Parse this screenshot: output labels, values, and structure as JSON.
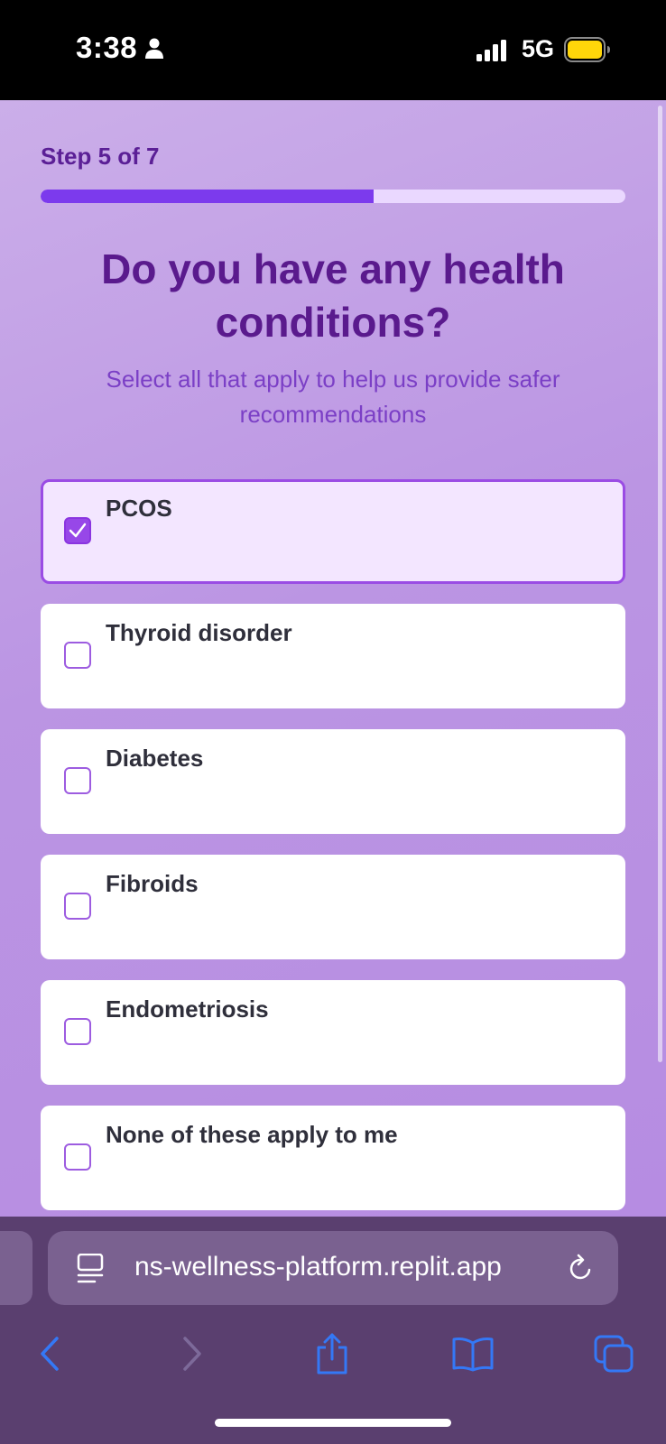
{
  "status_bar": {
    "time": "3:38",
    "network": "5G",
    "icons": [
      "person-icon",
      "signal-icon",
      "battery-icon"
    ],
    "battery_color": "#ffd60a"
  },
  "page": {
    "step_label": "Step 5 of 7",
    "progress": {
      "current": 5,
      "total": 7,
      "fraction": 0.57,
      "fill_color": "#7c3aed"
    },
    "heading": "Do you have any health conditions?",
    "subheading": "Select all that apply to help us provide safer recommendations",
    "options": [
      {
        "label": "PCOS",
        "checked": true
      },
      {
        "label": "Thyroid disorder",
        "checked": false
      },
      {
        "label": "Diabetes",
        "checked": false
      },
      {
        "label": "Fibroids",
        "checked": false
      },
      {
        "label": "Endometriosis",
        "checked": false
      },
      {
        "label": "None of these apply to me",
        "checked": false
      }
    ]
  },
  "browser": {
    "url": "ns-wellness-platform.replit.app",
    "icons": [
      "page-menu-icon",
      "reload-icon",
      "back-icon",
      "forward-icon",
      "share-icon",
      "bookmarks-icon",
      "tabs-icon"
    ],
    "accent_color": "#3478f6"
  }
}
